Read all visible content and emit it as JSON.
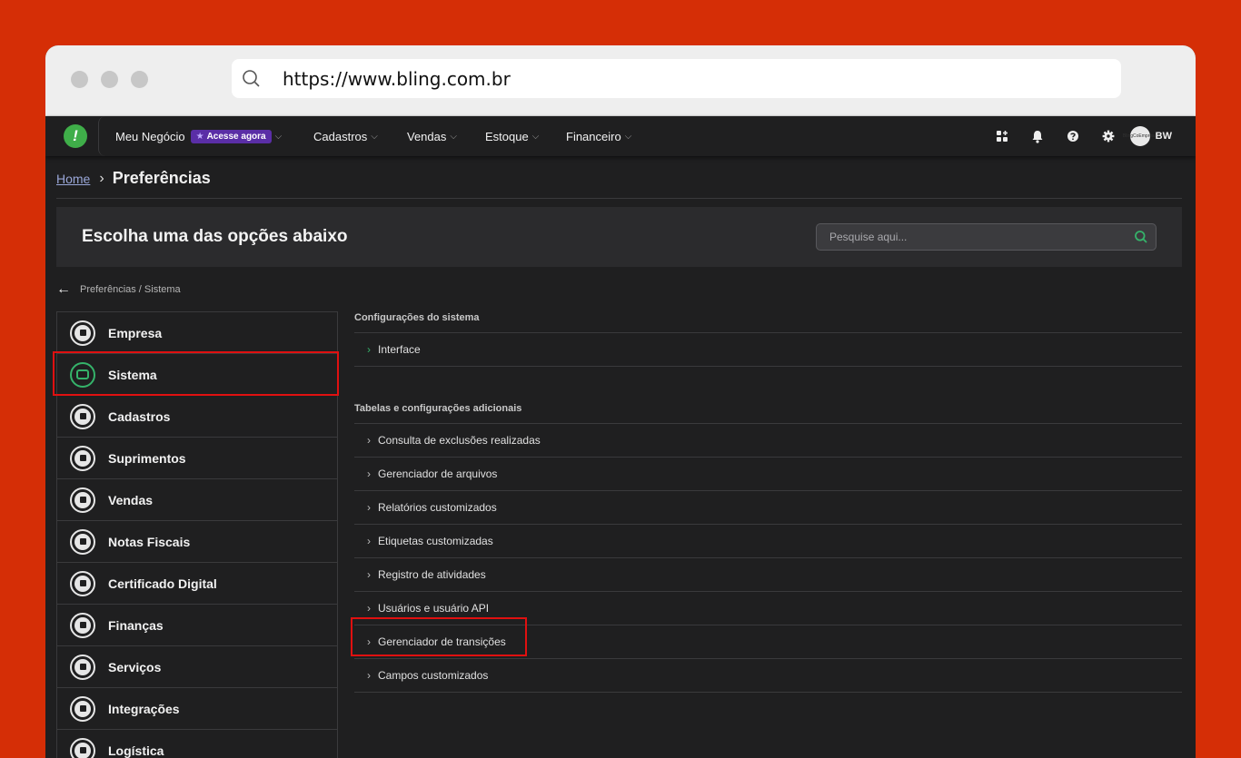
{
  "browser": {
    "url": "https://www.bling.com.br"
  },
  "topnav": {
    "logo_glyph": "!",
    "items": [
      {
        "label": "Meu Negócio",
        "badge": "Acesse agora"
      },
      {
        "label": "Cadastros"
      },
      {
        "label": "Vendas"
      },
      {
        "label": "Estoque"
      },
      {
        "label": "Financeiro"
      }
    ],
    "avatar_text": "BlingCoEmpresa",
    "user_initials": "BW"
  },
  "breadcrumb": {
    "home": "Home",
    "current": "Preferências"
  },
  "banner": {
    "title": "Escolha uma das opções abaixo",
    "search_placeholder": "Pesquise aqui..."
  },
  "subpath": "Preferências / Sistema",
  "sidebar": {
    "items": [
      {
        "label": "Empresa"
      },
      {
        "label": "Sistema"
      },
      {
        "label": "Cadastros"
      },
      {
        "label": "Suprimentos"
      },
      {
        "label": "Vendas"
      },
      {
        "label": "Notas Fiscais"
      },
      {
        "label": "Certificado Digital"
      },
      {
        "label": "Finanças"
      },
      {
        "label": "Serviços"
      },
      {
        "label": "Integrações"
      },
      {
        "label": "Logística"
      }
    ]
  },
  "sections": [
    {
      "title": "Configurações do sistema",
      "items": [
        {
          "label": "Interface"
        }
      ]
    },
    {
      "title": "Tabelas e configurações adicionais",
      "items": [
        {
          "label": "Consulta de exclusões realizadas"
        },
        {
          "label": "Gerenciador de arquivos"
        },
        {
          "label": "Relatórios customizados"
        },
        {
          "label": "Etiquetas customizadas"
        },
        {
          "label": "Registro de atividades"
        },
        {
          "label": "Usuários e usuário API"
        },
        {
          "label": "Gerenciador de transições"
        },
        {
          "label": "Campos customizados"
        }
      ]
    }
  ],
  "colors": {
    "background": "#d52e06",
    "accent_green": "#35b36a",
    "highlight_red": "#e01010",
    "badge_purple": "#5a2ea6"
  }
}
